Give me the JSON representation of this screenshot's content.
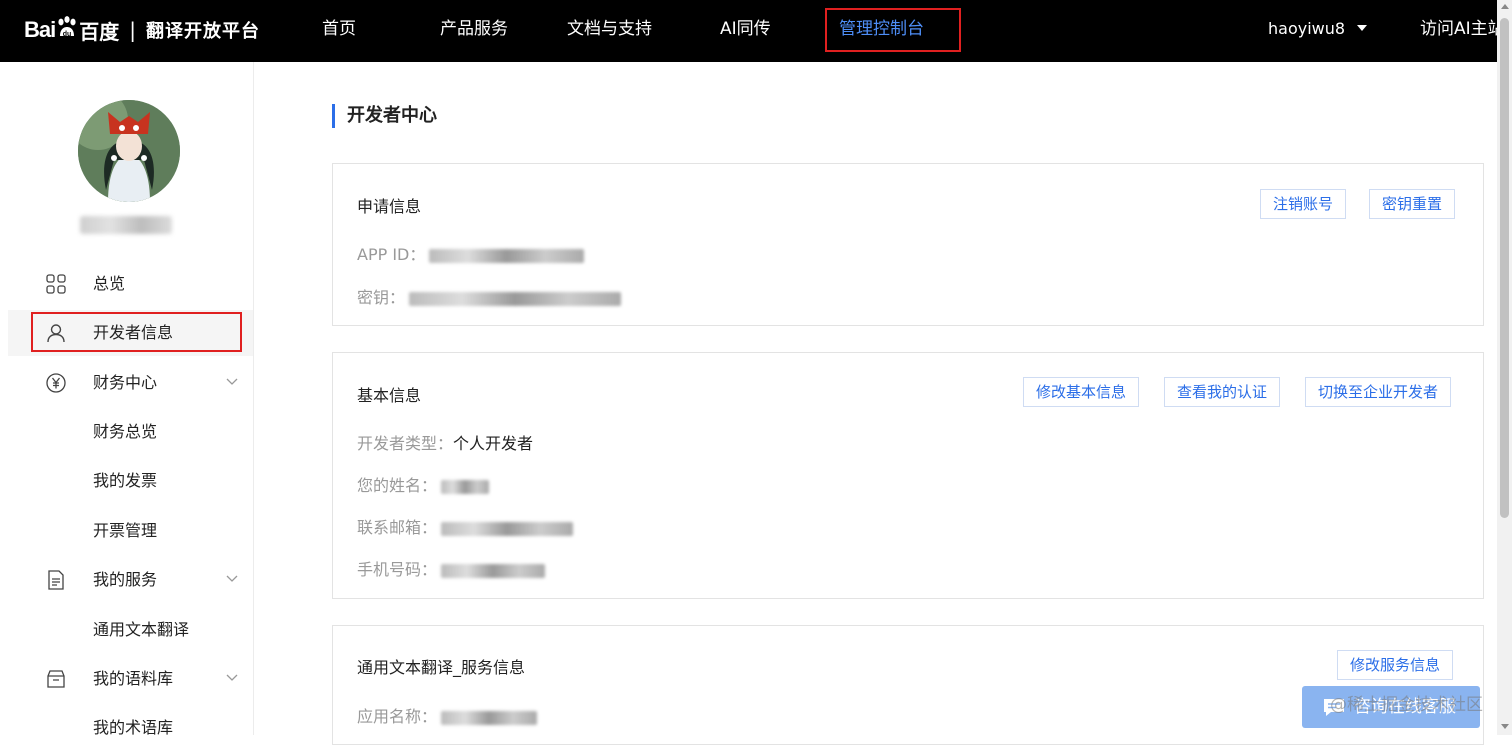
{
  "nav": {
    "logo_bai": "Bai",
    "logo_du": "百度",
    "logo_separator": "|",
    "logo_platform": "翻译开放平台",
    "items": [
      "首页",
      "产品服务",
      "文档与支持",
      "AI同传",
      "管理控制台"
    ],
    "user": "haoyiwu8",
    "visit": "访问AI主站"
  },
  "sidebar": {
    "items": [
      {
        "label": "总览",
        "icon": "grid-icon"
      },
      {
        "label": "开发者信息",
        "icon": "user-icon"
      },
      {
        "label": "财务中心",
        "icon": "yen-icon"
      },
      {
        "label": "财务总览"
      },
      {
        "label": "我的发票"
      },
      {
        "label": "开票管理"
      },
      {
        "label": "我的服务",
        "icon": "document-icon"
      },
      {
        "label": "通用文本翻译"
      },
      {
        "label": "我的语料库",
        "icon": "box-icon"
      },
      {
        "label": "我的术语库"
      }
    ]
  },
  "main": {
    "title": "开发者中心",
    "apply_card": {
      "title": "申请信息",
      "app_id_label": "APP ID：",
      "key_label": "密钥：",
      "cancel_account": "注销账号",
      "reset_key": "密钥重置"
    },
    "basic_card": {
      "title": "基本信息",
      "type_label": "开发者类型：",
      "type_value": "个人开发者",
      "name_label": "您的姓名：",
      "email_label": "联系邮箱：",
      "phone_label": "手机号码：",
      "edit_info": "修改基本信息",
      "view_auth": "查看我的认证",
      "switch_enterprise": "切换至企业开发者"
    },
    "service_card": {
      "title": "通用文本翻译_服务信息",
      "app_name_label": "应用名称：",
      "edit_service": "修改服务信息"
    }
  },
  "widget": {
    "consult": "咨询在线客服",
    "watermark": "@稀土掘金技术社区"
  },
  "colors": {
    "accent": "#2b6ee8",
    "nav_bg": "#000000",
    "highlight_box": "#e02020"
  }
}
